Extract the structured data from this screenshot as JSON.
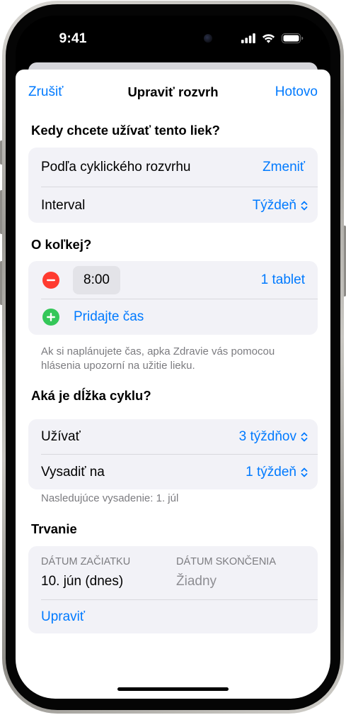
{
  "status_bar": {
    "time": "9:41",
    "icons": [
      "cellular-signal-icon",
      "wifi-icon",
      "battery-icon"
    ]
  },
  "nav": {
    "cancel": "Zrušiť",
    "title": "Upraviť rozvrh",
    "done": "Hotovo"
  },
  "schedule": {
    "header": "Kedy chcete užívať tento liek?",
    "type_label": "Podľa cyklického rozvrhu",
    "change_action": "Zmeniť",
    "interval_label": "Interval",
    "interval_value": "Týždeň"
  },
  "times": {
    "header": "O koľkej?",
    "doses": [
      {
        "time": "8:00",
        "amount": "1 tablet"
      }
    ],
    "add_time": "Pridajte čas",
    "footnote": "Ak si naplánujete čas, apka Zdravie vás pomocou hlásenia upozorní na užitie lieku."
  },
  "cycle": {
    "header": "Aká je dĺžka cyklu?",
    "take_label": "Užívať",
    "take_value": "3 týždňov",
    "pause_label": "Vysadiť na",
    "pause_value": "1 týždeň",
    "footnote": "Nasledujúce vysadenie: 1. júl"
  },
  "duration": {
    "header": "Trvanie",
    "start_label": "DÁTUM ZAČIATKU",
    "start_value": "10. jún (dnes)",
    "end_label": "DÁTUM SKONČENIA",
    "end_value": "Žiadny",
    "edit": "Upraviť"
  },
  "colors": {
    "accent": "#007aff",
    "destructive": "#ff3b30",
    "add": "#34c759",
    "group_background": "#f2f2f7",
    "secondary_text": "#7c7c80"
  }
}
